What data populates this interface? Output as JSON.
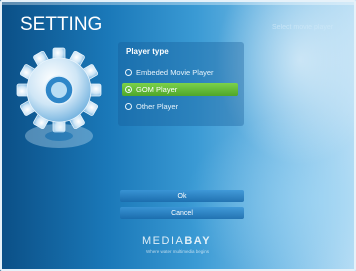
{
  "header": {
    "title": "SETTING",
    "hint": "Select movie player"
  },
  "panel": {
    "title": "Player type",
    "options": [
      {
        "label": "Embeded Movie Player",
        "selected": false
      },
      {
        "label": "GOM Player",
        "selected": true
      },
      {
        "label": "Other Player",
        "selected": false
      }
    ]
  },
  "buttons": {
    "ok": "Ok",
    "cancel": "Cancel"
  },
  "brand": {
    "name_light": "MEDIA",
    "name_bold": "BAY",
    "tagline": "Where water multimedia begins"
  },
  "icons": {
    "gear": "gear-icon"
  },
  "colors": {
    "accent": "#5cb832",
    "background": "#1a78b8"
  }
}
